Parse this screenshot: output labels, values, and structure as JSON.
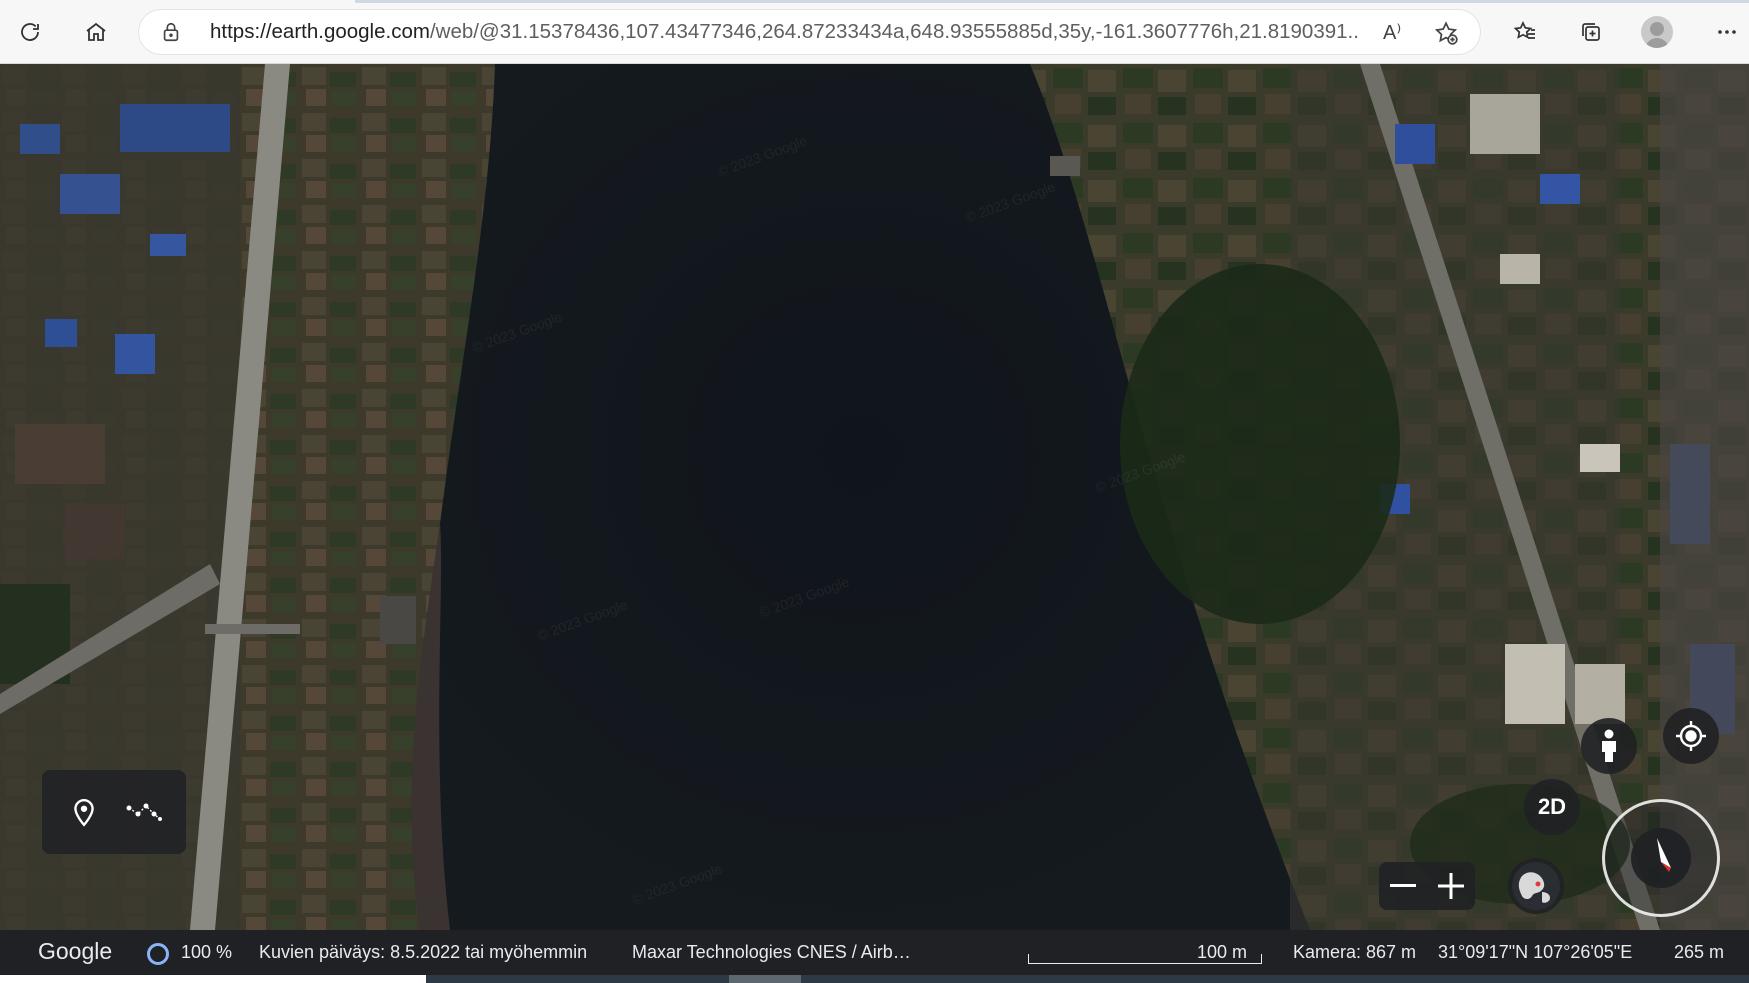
{
  "browser": {
    "url_main": "https://earth.google.com",
    "url_rest": "/web/@31.15378436,107.43477346,264.87233434a,648.93555885d,35y,-161.3607776h,21.8190391...",
    "read_aloud_label": "A⁾",
    "icons": [
      "refresh-icon",
      "home-icon",
      "lock-icon",
      "read-aloud-icon",
      "add-favorite-icon",
      "favorites-icon",
      "collections-icon",
      "profile-icon",
      "more-icon"
    ]
  },
  "map": {
    "watermark": "© 2023 Google",
    "controls": {
      "view_mode_label": "2D",
      "zoom_out": "−",
      "zoom_in": "+"
    }
  },
  "status": {
    "logo": "Google",
    "load_percent": "100 %",
    "imagery_date": "Kuvien päiväys: 8.5.2022 tai myöhemmin",
    "providers": "Maxar Technologies   CNES / Airb…",
    "scale": "100 m",
    "camera": "Kamera: 867 m",
    "coordinates": "31°09'17\"N 107°26'05\"E",
    "elevation": "265 m"
  },
  "colors": {
    "water": "#12161c",
    "accent": "#8ab4f8"
  }
}
